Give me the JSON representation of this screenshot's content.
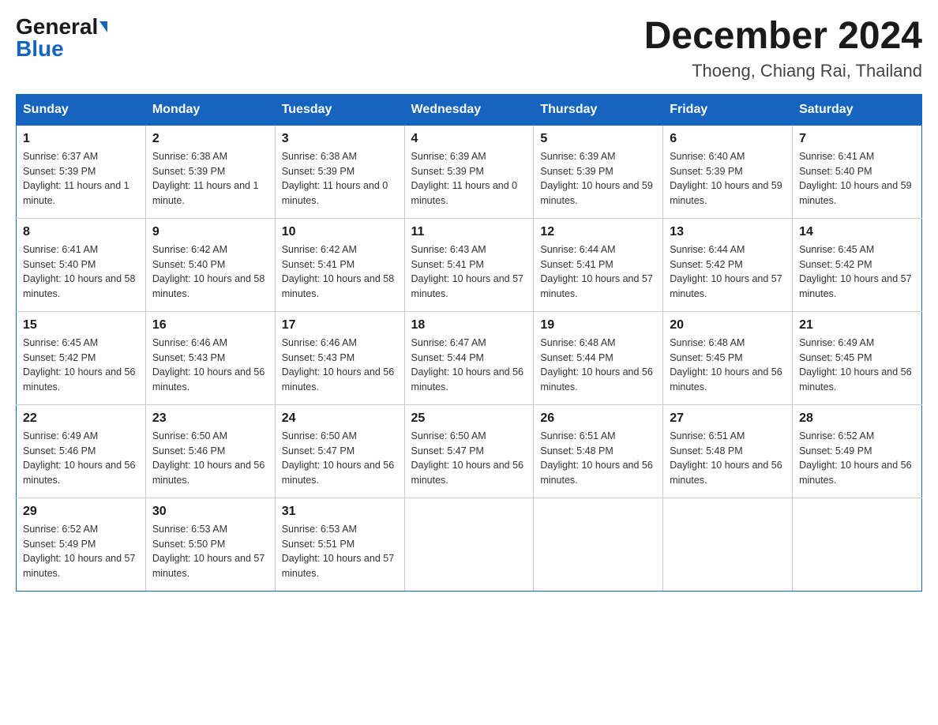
{
  "header": {
    "logo_general": "General",
    "logo_blue": "Blue",
    "month_title": "December 2024",
    "location": "Thoeng, Chiang Rai, Thailand"
  },
  "days_of_week": [
    "Sunday",
    "Monday",
    "Tuesday",
    "Wednesday",
    "Thursday",
    "Friday",
    "Saturday"
  ],
  "weeks": [
    [
      {
        "day": "1",
        "sunrise": "6:37 AM",
        "sunset": "5:39 PM",
        "daylight": "11 hours and 1 minute."
      },
      {
        "day": "2",
        "sunrise": "6:38 AM",
        "sunset": "5:39 PM",
        "daylight": "11 hours and 1 minute."
      },
      {
        "day": "3",
        "sunrise": "6:38 AM",
        "sunset": "5:39 PM",
        "daylight": "11 hours and 0 minutes."
      },
      {
        "day": "4",
        "sunrise": "6:39 AM",
        "sunset": "5:39 PM",
        "daylight": "11 hours and 0 minutes."
      },
      {
        "day": "5",
        "sunrise": "6:39 AM",
        "sunset": "5:39 PM",
        "daylight": "10 hours and 59 minutes."
      },
      {
        "day": "6",
        "sunrise": "6:40 AM",
        "sunset": "5:39 PM",
        "daylight": "10 hours and 59 minutes."
      },
      {
        "day": "7",
        "sunrise": "6:41 AM",
        "sunset": "5:40 PM",
        "daylight": "10 hours and 59 minutes."
      }
    ],
    [
      {
        "day": "8",
        "sunrise": "6:41 AM",
        "sunset": "5:40 PM",
        "daylight": "10 hours and 58 minutes."
      },
      {
        "day": "9",
        "sunrise": "6:42 AM",
        "sunset": "5:40 PM",
        "daylight": "10 hours and 58 minutes."
      },
      {
        "day": "10",
        "sunrise": "6:42 AM",
        "sunset": "5:41 PM",
        "daylight": "10 hours and 58 minutes."
      },
      {
        "day": "11",
        "sunrise": "6:43 AM",
        "sunset": "5:41 PM",
        "daylight": "10 hours and 57 minutes."
      },
      {
        "day": "12",
        "sunrise": "6:44 AM",
        "sunset": "5:41 PM",
        "daylight": "10 hours and 57 minutes."
      },
      {
        "day": "13",
        "sunrise": "6:44 AM",
        "sunset": "5:42 PM",
        "daylight": "10 hours and 57 minutes."
      },
      {
        "day": "14",
        "sunrise": "6:45 AM",
        "sunset": "5:42 PM",
        "daylight": "10 hours and 57 minutes."
      }
    ],
    [
      {
        "day": "15",
        "sunrise": "6:45 AM",
        "sunset": "5:42 PM",
        "daylight": "10 hours and 56 minutes."
      },
      {
        "day": "16",
        "sunrise": "6:46 AM",
        "sunset": "5:43 PM",
        "daylight": "10 hours and 56 minutes."
      },
      {
        "day": "17",
        "sunrise": "6:46 AM",
        "sunset": "5:43 PM",
        "daylight": "10 hours and 56 minutes."
      },
      {
        "day": "18",
        "sunrise": "6:47 AM",
        "sunset": "5:44 PM",
        "daylight": "10 hours and 56 minutes."
      },
      {
        "day": "19",
        "sunrise": "6:48 AM",
        "sunset": "5:44 PM",
        "daylight": "10 hours and 56 minutes."
      },
      {
        "day": "20",
        "sunrise": "6:48 AM",
        "sunset": "5:45 PM",
        "daylight": "10 hours and 56 minutes."
      },
      {
        "day": "21",
        "sunrise": "6:49 AM",
        "sunset": "5:45 PM",
        "daylight": "10 hours and 56 minutes."
      }
    ],
    [
      {
        "day": "22",
        "sunrise": "6:49 AM",
        "sunset": "5:46 PM",
        "daylight": "10 hours and 56 minutes."
      },
      {
        "day": "23",
        "sunrise": "6:50 AM",
        "sunset": "5:46 PM",
        "daylight": "10 hours and 56 minutes."
      },
      {
        "day": "24",
        "sunrise": "6:50 AM",
        "sunset": "5:47 PM",
        "daylight": "10 hours and 56 minutes."
      },
      {
        "day": "25",
        "sunrise": "6:50 AM",
        "sunset": "5:47 PM",
        "daylight": "10 hours and 56 minutes."
      },
      {
        "day": "26",
        "sunrise": "6:51 AM",
        "sunset": "5:48 PM",
        "daylight": "10 hours and 56 minutes."
      },
      {
        "day": "27",
        "sunrise": "6:51 AM",
        "sunset": "5:48 PM",
        "daylight": "10 hours and 56 minutes."
      },
      {
        "day": "28",
        "sunrise": "6:52 AM",
        "sunset": "5:49 PM",
        "daylight": "10 hours and 56 minutes."
      }
    ],
    [
      {
        "day": "29",
        "sunrise": "6:52 AM",
        "sunset": "5:49 PM",
        "daylight": "10 hours and 57 minutes."
      },
      {
        "day": "30",
        "sunrise": "6:53 AM",
        "sunset": "5:50 PM",
        "daylight": "10 hours and 57 minutes."
      },
      {
        "day": "31",
        "sunrise": "6:53 AM",
        "sunset": "5:51 PM",
        "daylight": "10 hours and 57 minutes."
      },
      null,
      null,
      null,
      null
    ]
  ]
}
